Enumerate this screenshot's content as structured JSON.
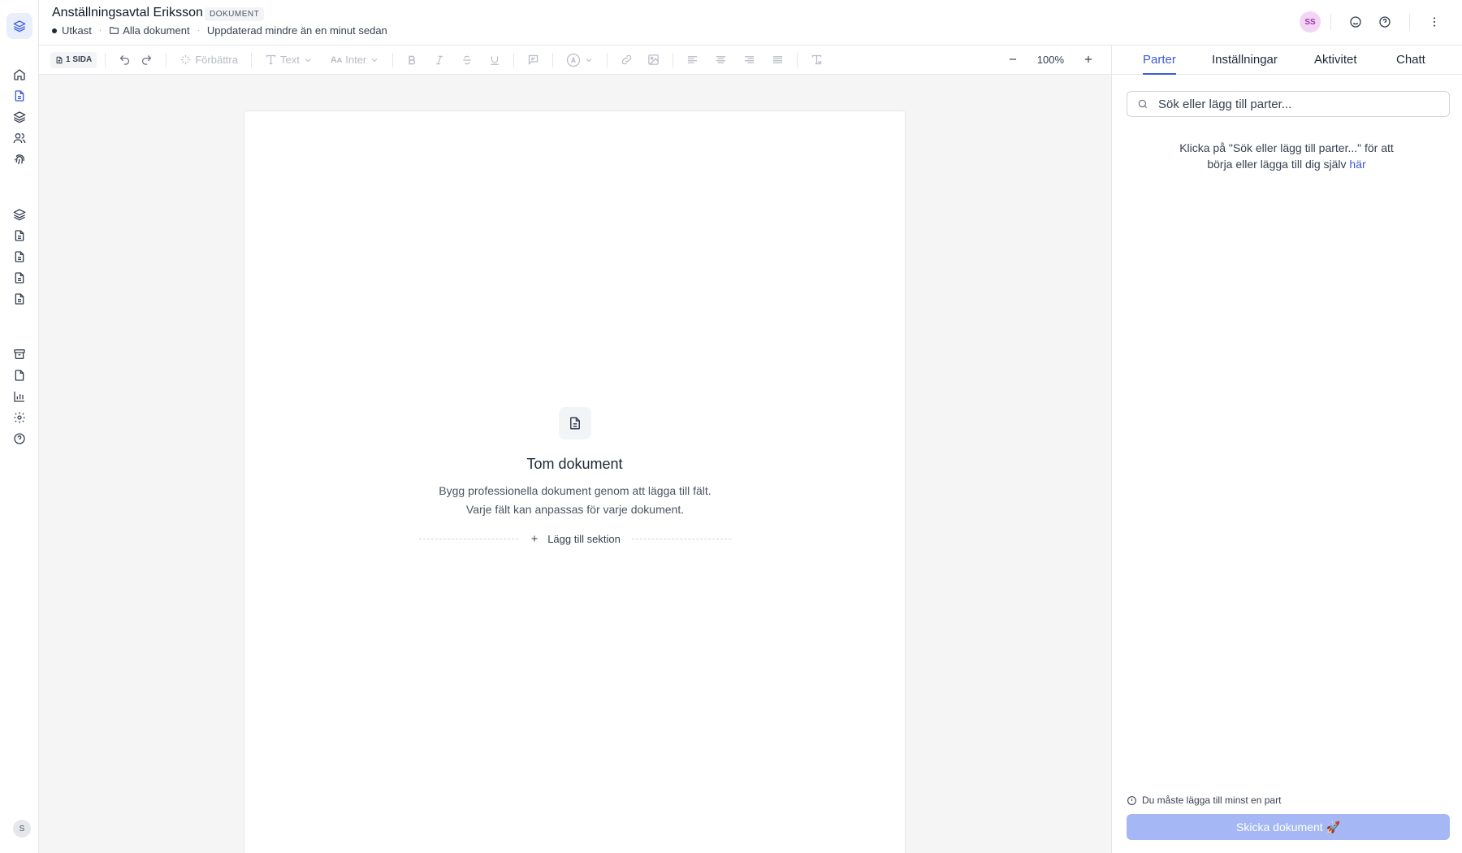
{
  "app": {
    "rail_top": [
      "home-icon",
      "document-icon",
      "layers-icon",
      "users-icon",
      "fingerprint-icon"
    ],
    "rail_mid": [
      "layers-icon",
      "document-icon",
      "document-icon",
      "document-icon",
      "document-icon"
    ],
    "rail_bottom": [
      "archive-icon",
      "file-icon",
      "chart-icon",
      "gear-icon",
      "help-icon"
    ],
    "user_initial": "S",
    "accent": "#3b5bdb"
  },
  "header": {
    "title": "Anställningsavtal Eriksson",
    "badge": "DOKUMENT",
    "status": "Utkast",
    "folder": "Alla dokument",
    "updated": "Uppdaterad mindre än en minut sedan",
    "avatar": "SS"
  },
  "toolbar": {
    "pages": "1 SIDA",
    "improve": "Förbättra",
    "text_style": "Text",
    "font": "Inter",
    "zoom": "100%"
  },
  "editor": {
    "empty_title": "Tom dokument",
    "empty_desc": "Bygg professionella dokument genom att lägga till fält. Varje fält kan anpassas för varje dokument.",
    "add_section": "Lägg till sektion"
  },
  "panel": {
    "tabs": [
      "Parter",
      "Inställningar",
      "Aktivitet",
      "Chatt"
    ],
    "active_tab": "Parter",
    "search_placeholder": "Sök eller lägg till parter...",
    "hint_text": "Klicka på \"Sök eller lägg till parter...\" för att börja eller lägga till dig själv",
    "hint_link": "här",
    "warning": "Du måste lägga till minst en part",
    "send_label": "Skicka dokument 🚀"
  }
}
